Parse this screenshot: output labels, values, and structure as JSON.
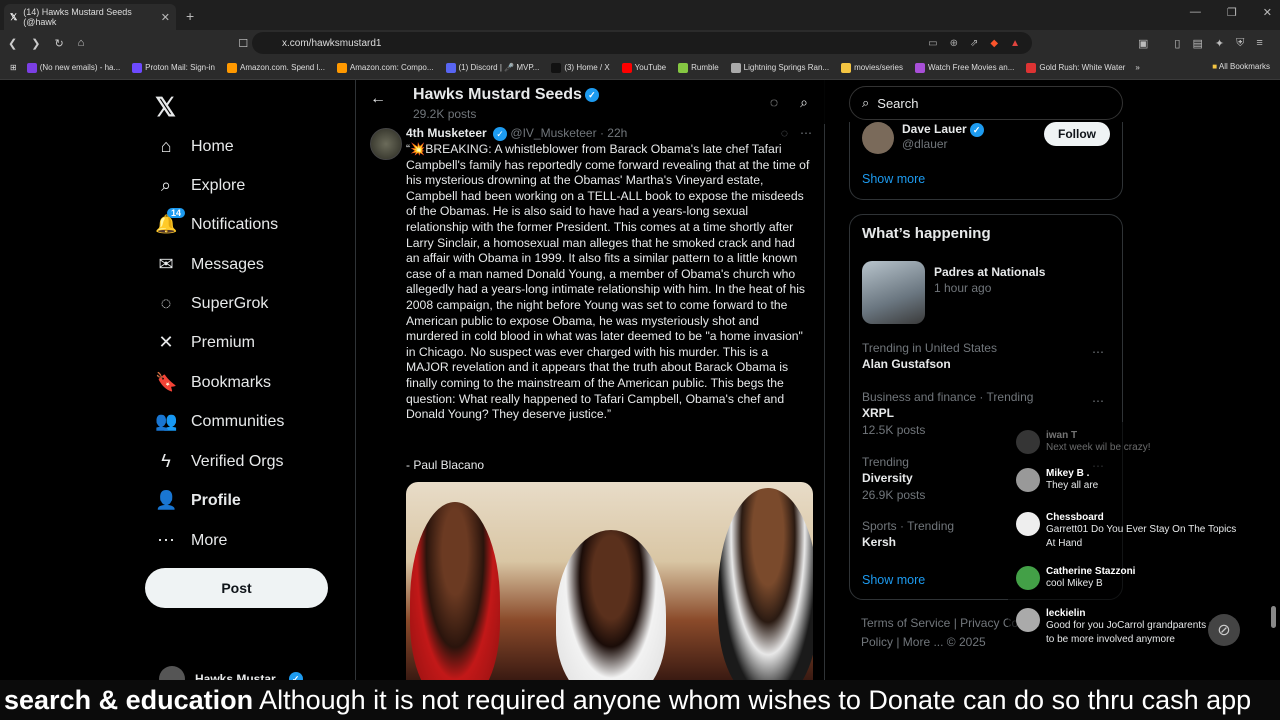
{
  "browser": {
    "tab_title": "(14) Hawks Mustard Seeds (@hawk",
    "url": "x.com/hawksmustard1",
    "bookmarks": [
      {
        "label": "(No new emails) - ha...",
        "color": "#7b3fe4"
      },
      {
        "label": "Proton Mail: Sign-in",
        "color": "#6d4aff"
      },
      {
        "label": "Amazon.com. Spend l...",
        "color": "#ff9900"
      },
      {
        "label": "Amazon.com: Compo...",
        "color": "#ff9900"
      },
      {
        "label": "(1) Discord | 🎤 MVP...",
        "color": "#5865f2"
      },
      {
        "label": "(3) Home / X",
        "color": "#111111"
      },
      {
        "label": "YouTube",
        "color": "#ff0000"
      },
      {
        "label": "Rumble",
        "color": "#85c742"
      },
      {
        "label": "Lightning Springs Ran...",
        "color": "#aaaaaa"
      },
      {
        "label": "movies/series",
        "color": "#f4c542"
      },
      {
        "label": "Watch Free Movies an...",
        "color": "#a84fd8"
      },
      {
        "label": "Gold Rush: White Water",
        "color": "#d33"
      }
    ],
    "all_bookmarks": "All Bookmarks"
  },
  "nav": {
    "items": [
      {
        "label": "Home",
        "icon": "home-icon",
        "glyph": "⌂"
      },
      {
        "label": "Explore",
        "icon": "search-icon",
        "glyph": "⌕"
      },
      {
        "label": "Notifications",
        "icon": "bell-icon",
        "glyph": "🔔"
      },
      {
        "label": "Messages",
        "icon": "mail-icon",
        "glyph": "✉"
      },
      {
        "label": "SuperGrok",
        "icon": "grok-icon",
        "glyph": "◌"
      },
      {
        "label": "Premium",
        "icon": "x-icon",
        "glyph": "✕"
      },
      {
        "label": "Bookmarks",
        "icon": "bookmark-icon",
        "glyph": "🔖"
      },
      {
        "label": "Communities",
        "icon": "people-icon",
        "glyph": "👥"
      },
      {
        "label": "Verified Orgs",
        "icon": "bolt-icon",
        "glyph": "ϟ"
      },
      {
        "label": "Profile",
        "icon": "person-icon",
        "glyph": "👤"
      },
      {
        "label": "More",
        "icon": "more-icon",
        "glyph": "⋯"
      }
    ],
    "notif_badge": "14",
    "post_label": "Post",
    "account_name": "Hawks Mustar"
  },
  "profile_header": {
    "name": "Hawks Mustard Seeds",
    "posts": "29.2K posts"
  },
  "tweet": {
    "author": "4th Musketeer",
    "handle": "@IV_Musketeer · 22h",
    "body": "“💥BREAKING: A whistleblower from Barack Obama's late chef Tafari Campbell's family has reportedly come forward revealing that at the time of his mysterious drowning at the Obamas' Martha's Vineyard estate, Campbell had been working on a TELL-ALL book to expose the misdeeds of the Obamas. He is also said to have had a years-long sexual relationship with the former President. This comes at a time shortly after Larry Sinclair, a homosexual man alleges that he smoked crack and had an affair with Obama in 1999. It also fits a similar pattern to a little known case of a man named Donald Young, a member of Obama's church who allegedly had a years-long intimate relationship with him. In the heat of his 2008 campaign, the night before Young was set to come forward to the American public to expose Obama, he was mysteriously shot and murdered in cold blood in what was later deemed to be \"a home invasion\" in Chicago. No suspect was ever charged with his murder. This is a MAJOR revelation and it appears that the truth about Barack Obama is finally coming to the mainstream of the American public. This begs the question: What really happened to Tafari Campbell, Obama's chef and Donald Young? They deserve justice.”",
    "signature": "- Paul Blacano"
  },
  "sidebar": {
    "search_placeholder": "Search",
    "suggestion": {
      "name": "Dave Lauer",
      "handle": "@dlauer",
      "follow": "Follow"
    },
    "show_more": "Show more",
    "happening_title": "What’s happening",
    "event": {
      "title": "Padres at Nationals",
      "time": "1 hour ago"
    },
    "trends": [
      {
        "context": "Trending in United States",
        "topic": "Alan Gustafson",
        "posts": ""
      },
      {
        "context": "Business and finance · Trending",
        "topic": "XRPL",
        "posts": "12.5K posts"
      },
      {
        "context": "Trending",
        "topic": "Diversity",
        "posts": "26.9K posts"
      },
      {
        "context": "Sports · Trending",
        "topic": "Kersh",
        "posts": ""
      }
    ],
    "show_more_2": "Show more",
    "footer": "Terms of Service | Privacy Cookie Policy | More ... © 2025"
  },
  "chat": [
    {
      "name": "iwan T",
      "text": "Next week wil be crazy!",
      "color": "#777"
    },
    {
      "name": "Mikey B .",
      "text": "They all are",
      "color": "#999"
    },
    {
      "name": "Chessboard",
      "text": "Garrett01 Do You Ever Stay On The Topics At Hand",
      "color": "#eee"
    },
    {
      "name": "Catherine Stazzoni",
      "text": "cool Mikey B",
      "color": "#43a047"
    },
    {
      "name": "leckielin",
      "text": "Good for you JoCarrol grandparents need to be more involved anymore",
      "color": "#aaa"
    }
  ],
  "ticker": {
    "bold": "search & education",
    "text": " Although it is not required anyone whom wishes to Donate can do so thru cash app"
  }
}
